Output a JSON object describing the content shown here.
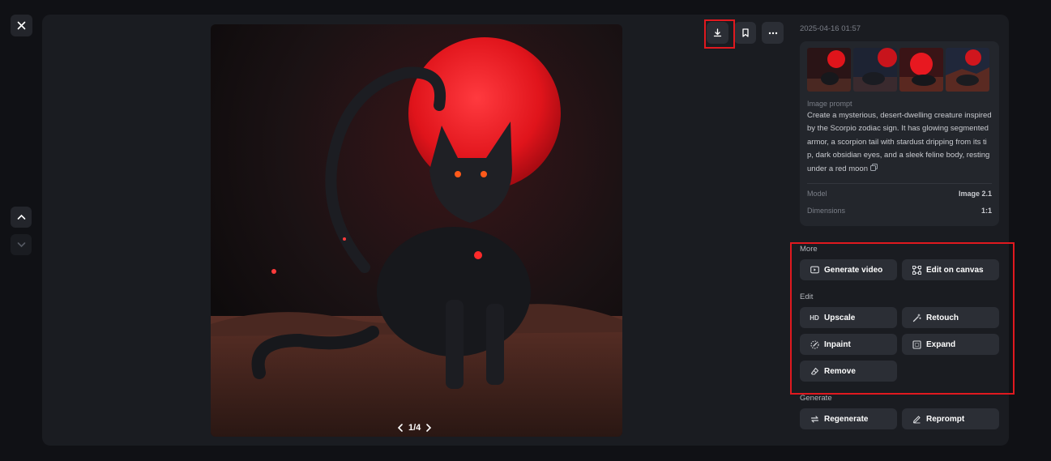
{
  "viewer": {
    "pager": {
      "current": "1/4"
    }
  },
  "details": {
    "timestamp": "2025-04-16 01:57",
    "prompt_label": "Image prompt",
    "prompt_text": "Create a mysterious, desert-dwelling creature inspired by the Scorpio zodiac sign. It has glowing segmented armor, a scorpion tail with stardust dripping from its tip, dark obsidian eyes, and a sleek feline body, resting under a red moon",
    "meta": [
      {
        "key": "Model",
        "value": "Image 2.1"
      },
      {
        "key": "Dimensions",
        "value": "1:1"
      }
    ]
  },
  "sections": {
    "more": {
      "title": "More",
      "buttons": [
        {
          "label": "Generate video",
          "icon": "video-icon"
        },
        {
          "label": "Edit on canvas",
          "icon": "canvas-icon"
        }
      ]
    },
    "edit": {
      "title": "Edit",
      "buttons": [
        {
          "label": "Upscale",
          "icon": "hd-icon",
          "icon_text": "HD"
        },
        {
          "label": "Retouch",
          "icon": "magic-wand-icon"
        },
        {
          "label": "Inpaint",
          "icon": "inpaint-icon"
        },
        {
          "label": "Expand",
          "icon": "expand-icon"
        },
        {
          "label": "Remove",
          "icon": "eraser-icon"
        }
      ]
    },
    "generate": {
      "title": "Generate",
      "buttons": [
        {
          "label": "Regenerate",
          "icon": "regenerate-icon"
        },
        {
          "label": "Reprompt",
          "icon": "pencil-icon"
        }
      ]
    }
  },
  "colors": {
    "background": "#101115",
    "panel": "#1a1c21",
    "button": "#2b2e35",
    "highlight": "#e0191f",
    "moon": "#e5141c"
  }
}
